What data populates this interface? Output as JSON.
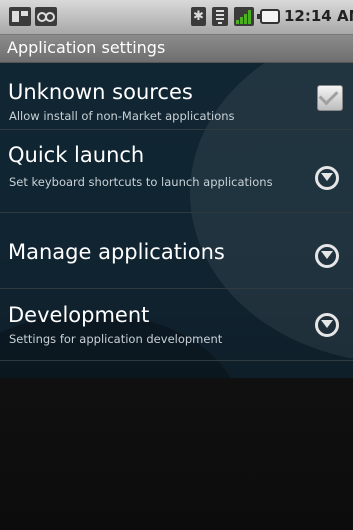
{
  "status_bar": {
    "icons": [
      "notification-icon",
      "voicemail-icon",
      "bluetooth-icon",
      "wifi-icon",
      "signal-icon",
      "battery-icon"
    ],
    "time": "12:14 AM"
  },
  "title_bar": {
    "title": "Application settings"
  },
  "settings": [
    {
      "title": "Unknown sources",
      "summary": "Allow install of non-Market applications",
      "control": "checkbox",
      "checked": false
    },
    {
      "title": "Quick launch",
      "summary": "Set keyboard shortcuts to launch applications",
      "control": "chevron"
    },
    {
      "title": "Manage applications",
      "summary": "",
      "control": "chevron"
    },
    {
      "title": "Development",
      "summary": "Settings for application development",
      "control": "chevron"
    }
  ],
  "colors": {
    "status_bar": "#c0c0c0",
    "title_bar": "#7d7d7d",
    "list_background": "#112633",
    "signal_green": "#4caf1d"
  }
}
